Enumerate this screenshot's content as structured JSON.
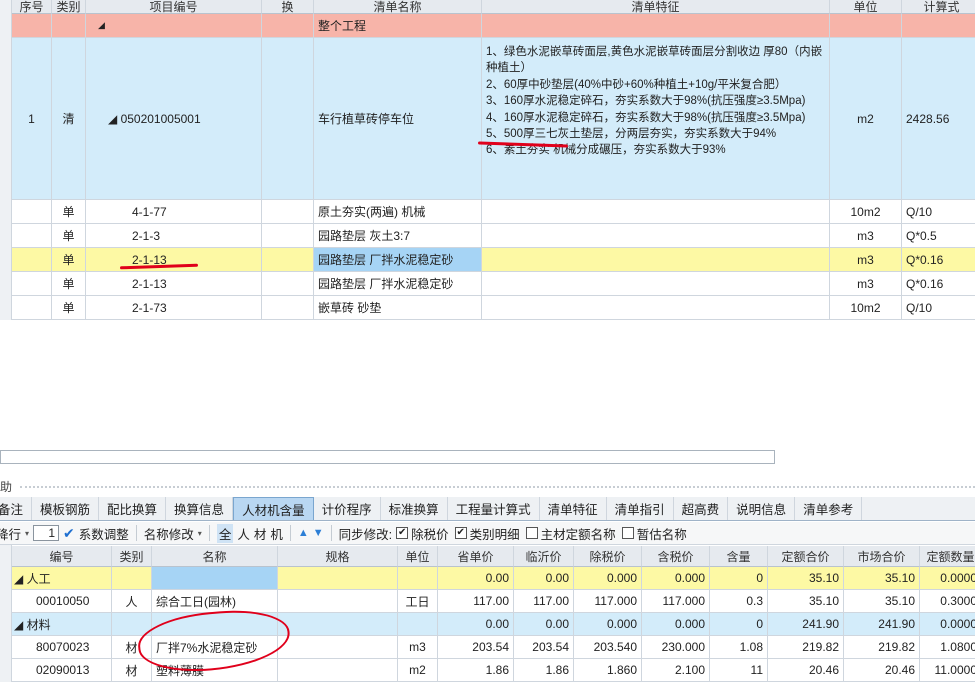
{
  "upper_table": {
    "headers": [
      "序号",
      "类别",
      "项目编号",
      "换",
      "清单名称",
      "清单特征",
      "单位",
      "计算式"
    ],
    "total_row": {
      "code": "◢",
      "name": "整个工程"
    },
    "main_row": {
      "seq": "1",
      "type": "清",
      "code": "◢ 050201005001",
      "name": "车行植草砖停车位",
      "features": [
        "1、绿色水泥嵌草砖面层,黄色水泥嵌草砖面层分割收边 厚80（内嵌种植土）",
        "2、60厚中砂垫层(40%中砂+60%种植土+10g/平米复合肥）",
        "3、160厚水泥稳定碎石，夯实系数大于98%(抗压强度≥3.5Mpa)",
        "4、160厚水泥稳定碎石，夯实系数大于98%(抗压强度≥3.5Mpa)",
        "5、500厚三七灰土垫层，分两层夯实，夯实系数大于94%",
        "6、素土夯实 机械分成碾压，夯实系数大于93%"
      ],
      "unit": "m2",
      "formula": "2428.56"
    },
    "sub_rows": [
      {
        "type": "单",
        "code": "4-1-77",
        "name": "原土夯实(两遍) 机械",
        "unit": "10m2",
        "formula": "Q/10"
      },
      {
        "type": "单",
        "code": "2-1-3",
        "name": "园路垫层 灰土3:7",
        "unit": "m3",
        "formula": "Q*0.5"
      },
      {
        "type": "单",
        "code": "2-1-13",
        "name": "园路垫层 厂拌水泥稳定砂",
        "unit": "m3",
        "formula": "Q*0.16"
      },
      {
        "type": "单",
        "code": "2-1-13",
        "name": "园路垫层 厂拌水泥稳定砂",
        "unit": "m3",
        "formula": "Q*0.16"
      },
      {
        "type": "单",
        "code": "2-1-73",
        "name": "嵌草砖 砂垫",
        "unit": "10m2",
        "formula": "Q/10"
      }
    ]
  },
  "panel": {
    "title": "助"
  },
  "tabs": [
    "备注",
    "模板钢筋",
    "配比换算",
    "换算信息",
    "人材机含量",
    "计价程序",
    "标准换算",
    "工程量计算式",
    "清单特征",
    "清单指引",
    "超高费",
    "说明信息",
    "清单参考"
  ],
  "active_tab": "人材机含量",
  "toolbar": {
    "row_label": "降行",
    "row_value": "1",
    "coef_adjust": "系数调整",
    "name_modify": "名称修改",
    "filters": [
      "全",
      "人",
      "材",
      "机"
    ],
    "sync_label": "同步修改:",
    "options": [
      {
        "label": "除税价",
        "checked": true
      },
      {
        "label": "类别明细",
        "checked": true
      },
      {
        "label": "主材定额名称",
        "checked": false
      },
      {
        "label": "暂估名称",
        "checked": false
      }
    ]
  },
  "lower_table": {
    "headers": [
      "编号",
      "类别",
      "名称",
      "规格",
      "单位",
      "省单价",
      "临沂价",
      "除税价",
      "含税价",
      "含量",
      "定额合价",
      "市场合价",
      "定额数量"
    ],
    "rows": [
      {
        "kind": "cat",
        "code": "◢ 人工",
        "type": "",
        "name": "",
        "spec": "",
        "unit": "",
        "p1": "0.00",
        "p2": "0.00",
        "p3": "0.000",
        "p4": "0.000",
        "qty": "0",
        "t1": "35.10",
        "t2": "35.10",
        "t3": "0.0000"
      },
      {
        "kind": "item",
        "code": "00010050",
        "type": "人",
        "name": "综合工日(园林)",
        "spec": "",
        "unit": "工日",
        "p1": "117.00",
        "p2": "117.00",
        "p3": "117.000",
        "p4": "117.000",
        "qty": "0.3",
        "t1": "35.10",
        "t2": "35.10",
        "t3": "0.3000"
      },
      {
        "kind": "cat2",
        "code": "◢ 材料",
        "type": "",
        "name": "",
        "spec": "",
        "unit": "",
        "p1": "0.00",
        "p2": "0.00",
        "p3": "0.000",
        "p4": "0.000",
        "qty": "0",
        "t1": "241.90",
        "t2": "241.90",
        "t3": "0.0000"
      },
      {
        "kind": "item",
        "code": "80070023",
        "type": "材",
        "name": "厂拌7%水泥稳定砂",
        "spec": "",
        "unit": "m3",
        "p1": "203.54",
        "p2": "203.54",
        "p3": "203.540",
        "p4": "230.000",
        "qty": "1.08",
        "t1": "219.82",
        "t2": "219.82",
        "t3": "1.0800"
      },
      {
        "kind": "item",
        "code": "02090013",
        "type": "材",
        "name": "塑料薄膜",
        "spec": "",
        "unit": "m2",
        "p1": "1.86",
        "p2": "1.86",
        "p3": "1.860",
        "p4": "2.100",
        "qty": "11",
        "t1": "20.46",
        "t2": "20.46",
        "t3": "11.0000"
      }
    ]
  },
  "colors": {
    "total_row": "#f7b4a9",
    "main_row": "#d3ecfa",
    "highlight_row": "#fdf9a4",
    "selected_cell": "#a6d4f5",
    "annotation": "#e0001b"
  }
}
